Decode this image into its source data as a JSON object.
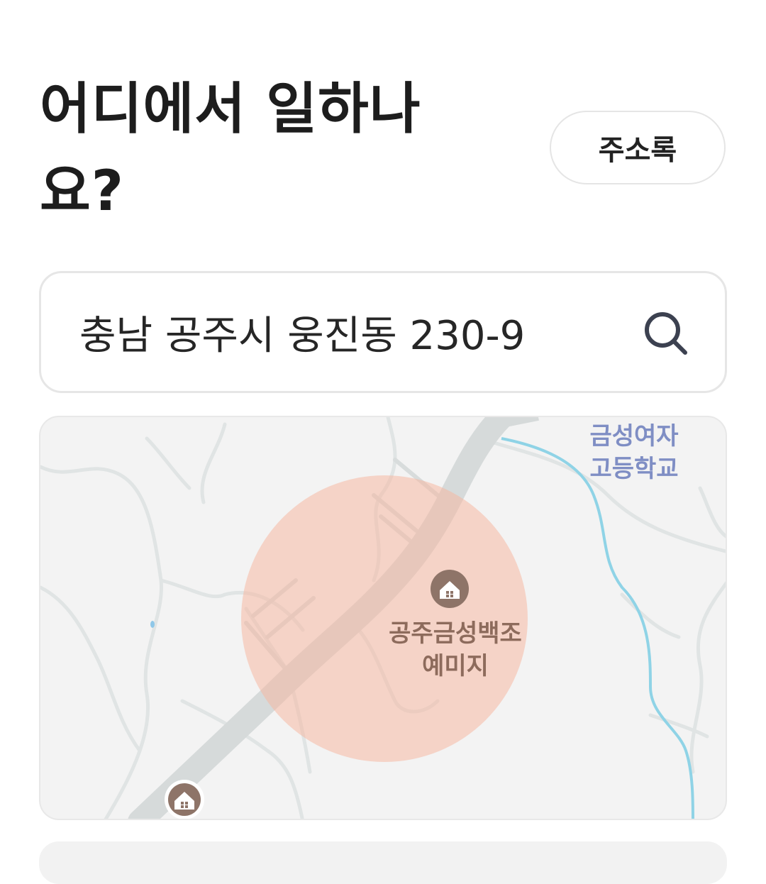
{
  "header": {
    "title": "어디에서 일하나\n요?",
    "address_book_label": "주소록"
  },
  "search": {
    "value": "충남 공주시 웅진동 230-9",
    "icon": "search-icon"
  },
  "map": {
    "labels": {
      "school": "금성여자\n고등학교",
      "place": "공주금성백조\n예미지"
    },
    "icons": [
      "home-pin-icon",
      "home-pin-icon"
    ],
    "colors": {
      "background": "#f3f3f3",
      "road": "#d9dddd",
      "minor_road": "#e2e6e6",
      "river": "#8fd3e6",
      "radius_circle": "#f6b8a2",
      "pin": "#8e7468"
    }
  }
}
